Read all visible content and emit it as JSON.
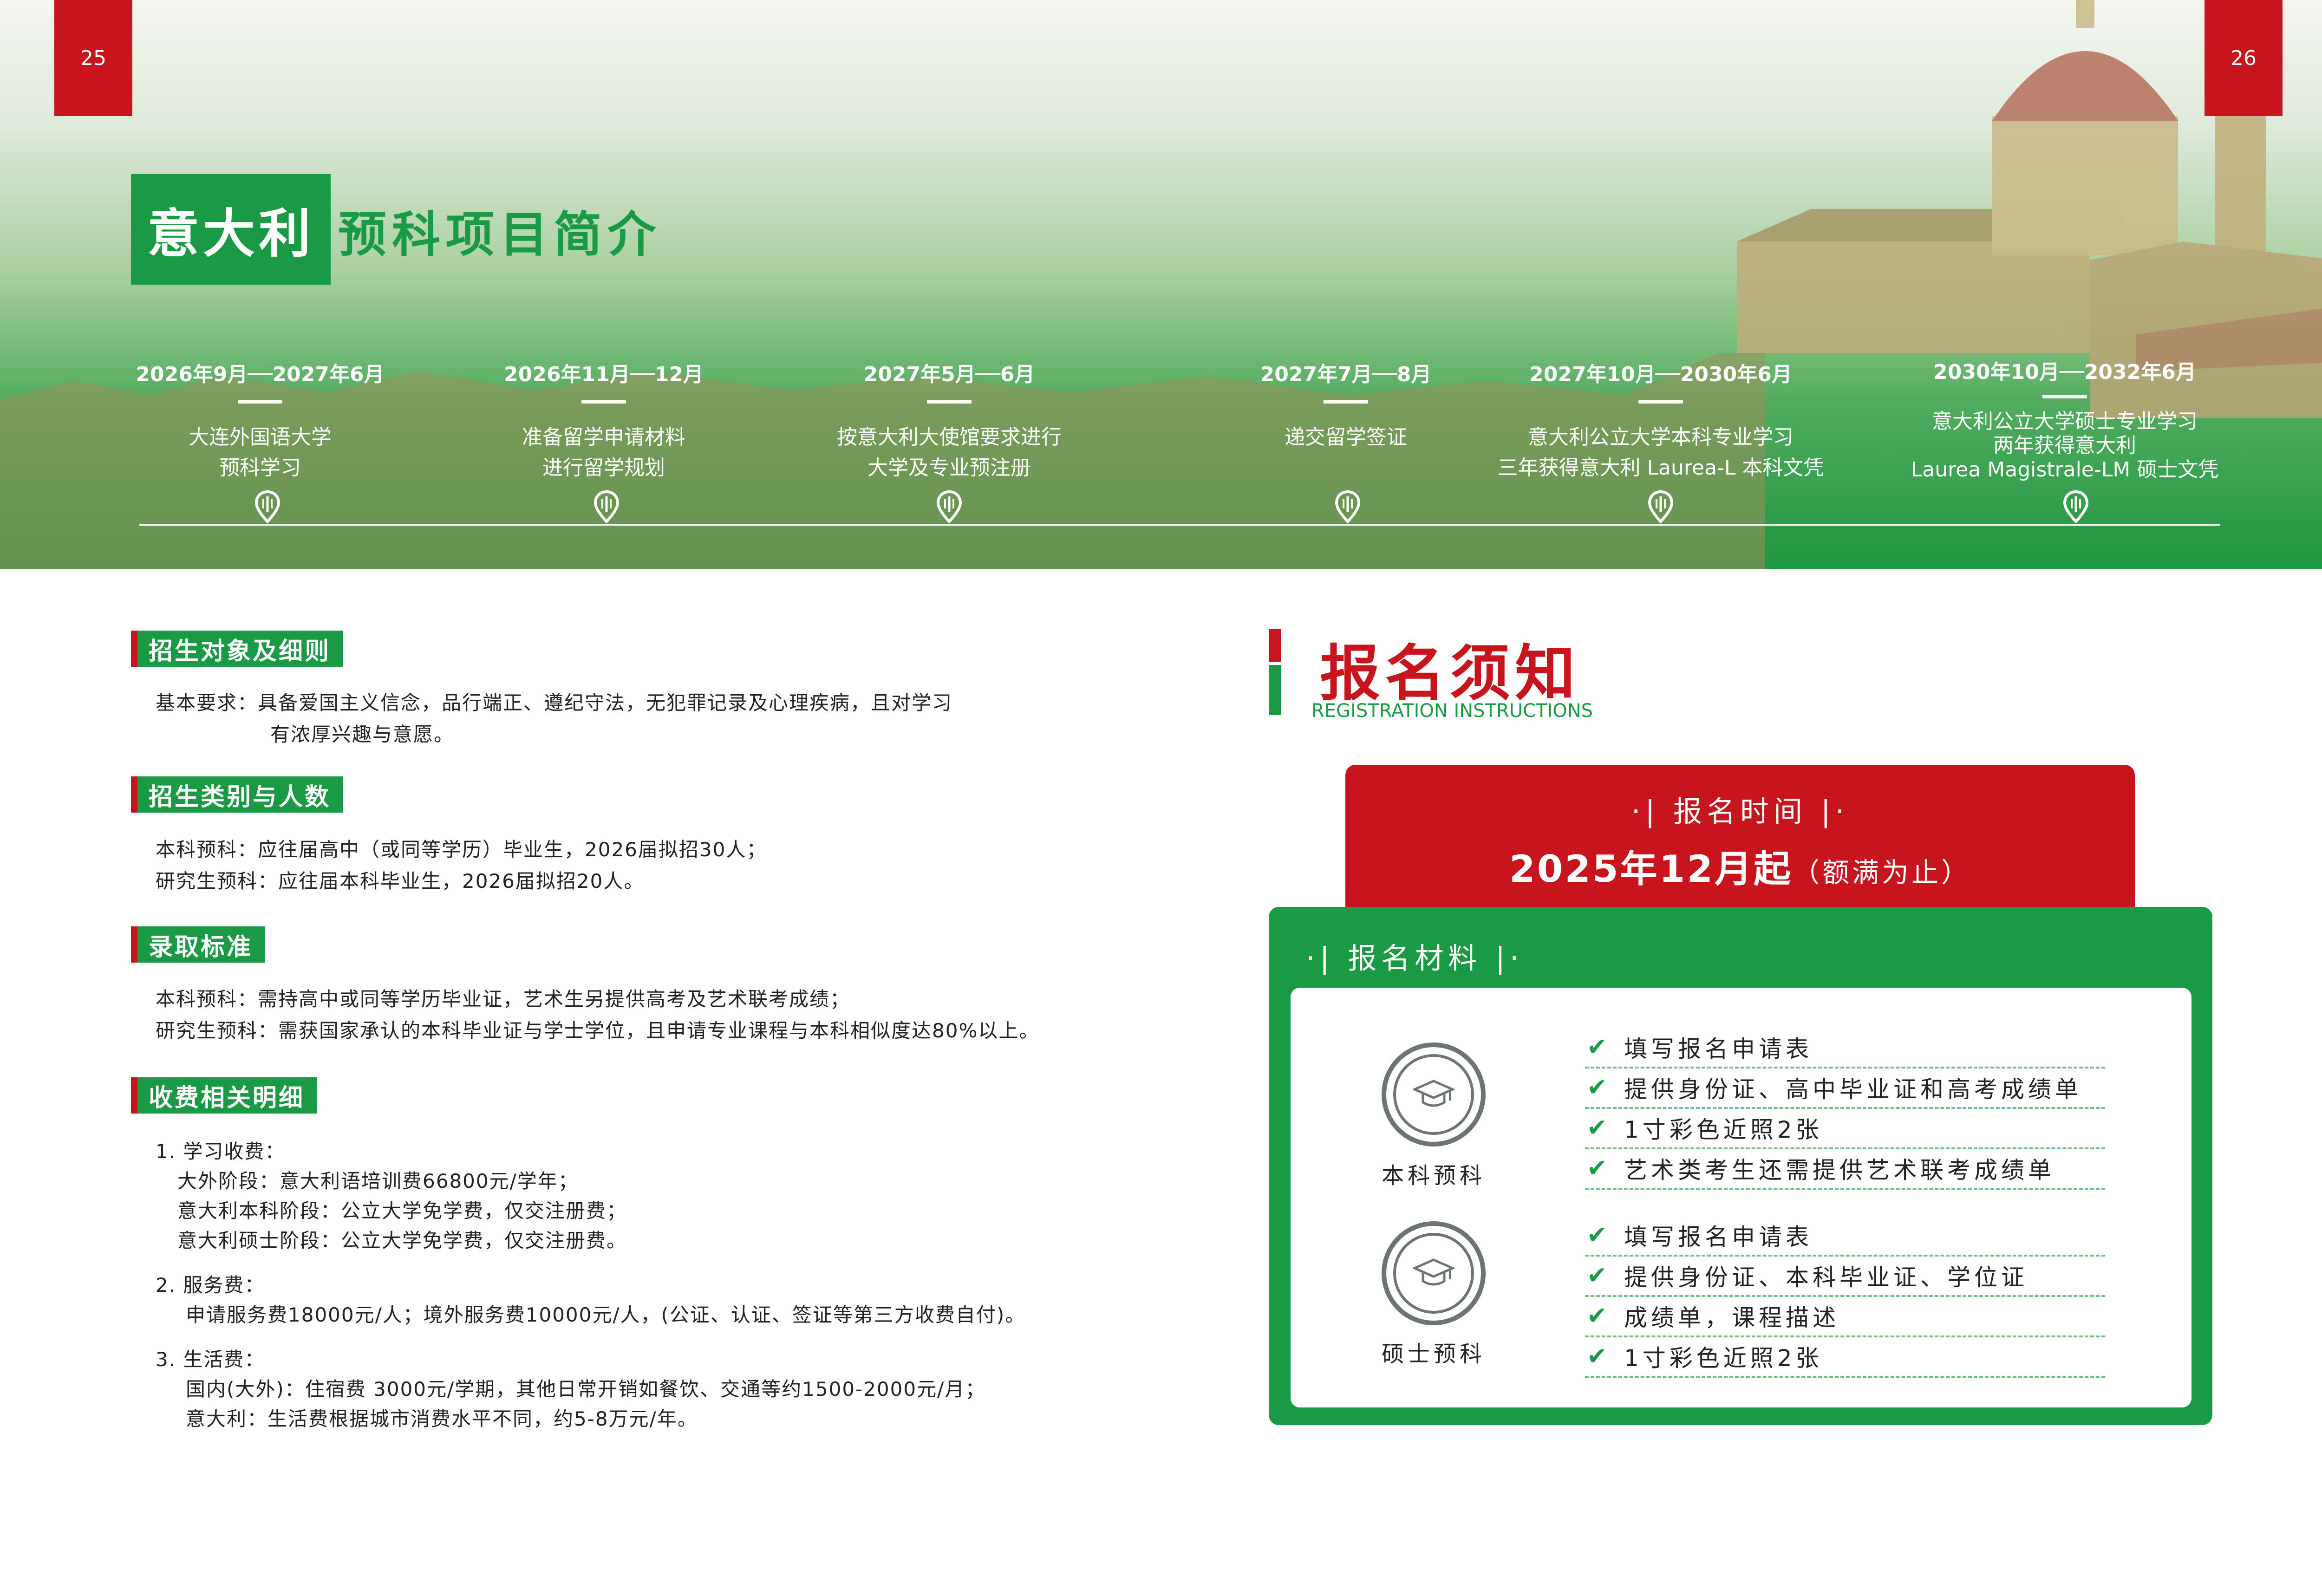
{
  "pages": {
    "left": "25",
    "right": "26"
  },
  "title": {
    "highlight": "意大利",
    "rest": "预科项目简介"
  },
  "timeline": [
    {
      "date": "2026年9月──2027年6月",
      "desc": [
        "大连外国语大学",
        "预科学习"
      ]
    },
    {
      "date": "2026年11月──12月",
      "desc": [
        "准备留学申请材料",
        "进行留学规划"
      ]
    },
    {
      "date": "2027年5月──6月",
      "desc": [
        "按意大利大使馆要求进行",
        "大学及专业预注册"
      ]
    },
    {
      "date": "2027年7月──8月",
      "desc": [
        "递交留学签证"
      ]
    },
    {
      "date": "2027年10月──2030年6月",
      "desc": [
        "意大利公立大学本科专业学习",
        "三年获得意大利 Laurea-L 本科文凭"
      ]
    },
    {
      "date": "2030年10月──2032年6月",
      "desc": [
        "意大利公立大学硕士专业学习",
        "两年获得意大利",
        "Laurea Magistrale-LM 硕士文凭"
      ]
    }
  ],
  "sections": {
    "s1": {
      "title": "招生对象及细则",
      "lines": [
        "基本要求：具备爱国主义信念，品行端正、遵纪守法，无犯罪记录及心理疾病，且对学习",
        "有浓厚兴趣与意愿。"
      ]
    },
    "s2": {
      "title": "招生类别与人数",
      "lines": [
        "本科预科：应往届高中（或同等学历）毕业生，2026届拟招30人；",
        "研究生预科：应往届本科毕业生，2026届拟招20人。"
      ]
    },
    "s3": {
      "title": "录取标准",
      "lines": [
        "本科预科：需持高中或同等学历毕业证，艺术生另提供高考及艺术联考成绩；",
        "研究生预科：需获国家承认的本科毕业证与学士学位，且申请专业课程与本科相似度达80%以上。"
      ]
    },
    "s4": {
      "title": "收费相关明细",
      "lines": [
        "1. 学习收费：",
        "大外阶段：意大利语培训费66800元/学年；",
        "意大利本科阶段：公立大学免学费，仅交注册费；",
        "意大利硕士阶段：公立大学免学费，仅交注册费。",
        "2. 服务费：",
        "申请服务费18000元/人；境外服务费10000元/人，(公证、认证、签证等第三方收费自付)。",
        "3. 生活费：",
        "国内(大外)：住宿费 3000元/学期，其他日常开销如餐饮、交通等约1500-2000元/月；",
        "意大利：生活费根据城市消费水平不同，约5-8万元/年。"
      ]
    }
  },
  "registration": {
    "title": "报名须知",
    "subtitle": "REGISTRATION INSTRUCTIONS",
    "time_label": "·|  报名时间  |·",
    "time_value": "2025年12月起",
    "time_note": "（额满为止）",
    "materials_label": "·|  报名材料  |·",
    "groups": [
      {
        "name": "本科预科",
        "icon": "graduation-cap-icon",
        "items": [
          "填写报名申请表",
          "提供身份证、高中毕业证和高考成绩单",
          "1寸彩色近照2张",
          "艺术类考生还需提供艺术联考成绩单"
        ]
      },
      {
        "name": "硕士预科",
        "icon": "graduation-cap-icon",
        "items": [
          "填写报名申请表",
          "提供身份证、本科毕业证、学位证",
          "成绩单，课程描述",
          "1寸彩色近照2张"
        ]
      }
    ]
  },
  "colors": {
    "green": "#1b9a45",
    "red": "#c8151d"
  }
}
